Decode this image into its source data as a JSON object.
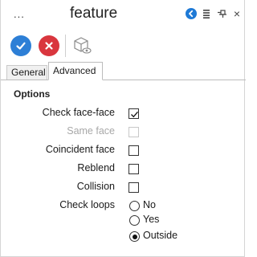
{
  "header": {
    "ellipsis": "...",
    "title": "feature",
    "close_glyph": "×"
  },
  "tabs": [
    {
      "label": "General",
      "active": false
    },
    {
      "label": "Advanced",
      "active": true
    }
  ],
  "options": {
    "section_title": "Options",
    "checks": [
      {
        "label": "Check face-face",
        "checked": true,
        "enabled": true
      },
      {
        "label": "Same face",
        "checked": false,
        "enabled": false
      },
      {
        "label": "Coincident face",
        "checked": false,
        "enabled": true
      },
      {
        "label": "Reblend",
        "checked": false,
        "enabled": true
      },
      {
        "label": "Collision",
        "checked": false,
        "enabled": true
      }
    ],
    "check_loops": {
      "label": "Check loops",
      "choices": [
        "No",
        "Yes",
        "Outside"
      ],
      "selected": "Outside"
    }
  },
  "colors": {
    "ok": "#2d7fd6",
    "cancel": "#d9363e",
    "back": "#1f7ad6"
  }
}
